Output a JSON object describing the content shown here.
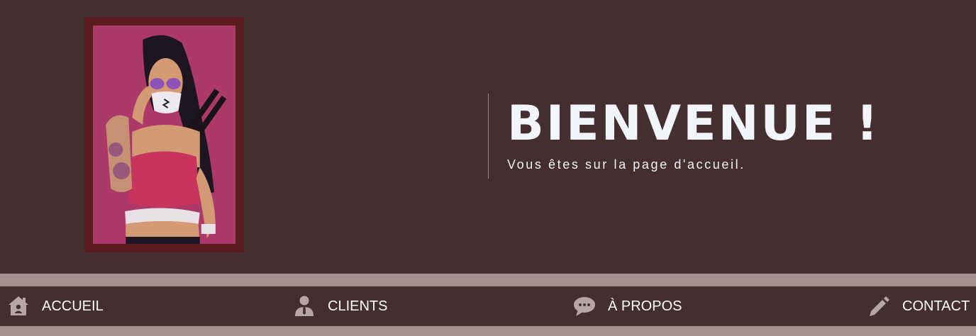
{
  "hero": {
    "title": "BIENVENUE !",
    "subtitle": "Vous êtes sur la page d'accueil."
  },
  "nav": {
    "items": [
      {
        "label": "ACCUEIL",
        "icon": "home-icon"
      },
      {
        "label": "CLIENTS",
        "icon": "user-icon"
      },
      {
        "label": "À PROPOS",
        "icon": "chat-icon"
      },
      {
        "label": "CONTACT",
        "icon": "pencil-icon"
      }
    ]
  },
  "colors": {
    "background": "#442e2f",
    "band": "#a89091",
    "frame": "#5a1c1e",
    "title_text": "#f2f6fb",
    "icon": "#b8a5a6"
  }
}
